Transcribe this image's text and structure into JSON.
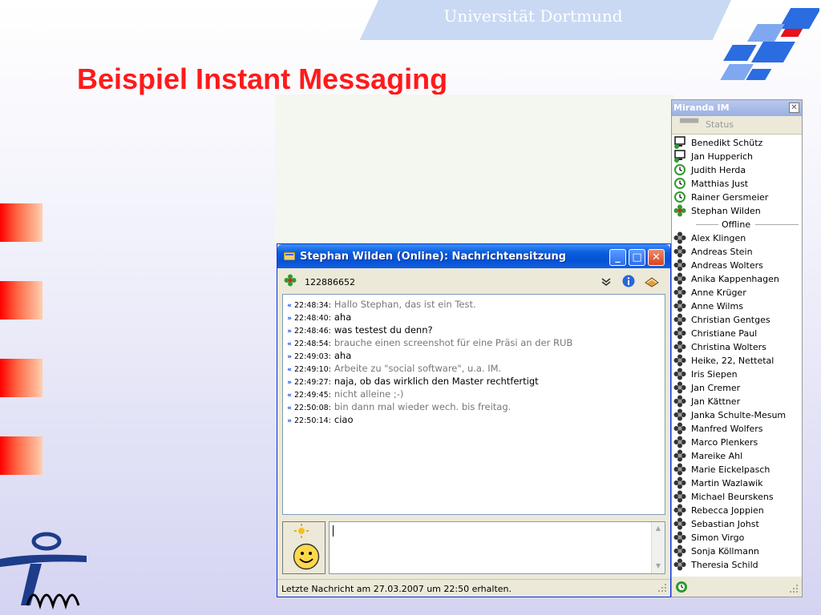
{
  "header": {
    "university": "Universität Dortmund",
    "slide_title": "Beispiel Instant Messaging"
  },
  "chat_window": {
    "title": "Stephan Wilden (Online): Nachrichtensitzung",
    "uin": "122886652",
    "buttons": {
      "minimize": "_",
      "maximize": "□",
      "close": "✕"
    },
    "messages": [
      {
        "dir": "in",
        "time": "22:48:34:",
        "text": "Hallo Stephan, das ist ein Test."
      },
      {
        "dir": "out",
        "time": "22:48:40:",
        "text": "aha"
      },
      {
        "dir": "out",
        "time": "22:48:46:",
        "text": "was testest du denn?"
      },
      {
        "dir": "in",
        "time": "22:48:54:",
        "text": "brauche einen screenshot für eine Präsi an der RUB"
      },
      {
        "dir": "out",
        "time": "22:49:03:",
        "text": "aha"
      },
      {
        "dir": "in",
        "time": "22:49:10:",
        "text": "Arbeite zu \"social software\", u.a. IM."
      },
      {
        "dir": "out",
        "time": "22:49:27:",
        "text": "naja, ob das wirklich den Master rechtfertigt"
      },
      {
        "dir": "in",
        "time": "22:49:45:",
        "text": "nicht alleine ;-)"
      },
      {
        "dir": "in",
        "time": "22:50:08:",
        "text": "bin dann mal wieder wech. bis freitag."
      },
      {
        "dir": "out",
        "time": "22:50:14:",
        "text": "ciao"
      }
    ],
    "status_text": "Letzte Nachricht am 27.03.2007 um 22:50 erhalten."
  },
  "miranda": {
    "title": "Miranda IM",
    "close_label": "✕",
    "status_label": "Status",
    "online_contacts": [
      {
        "name": "Benedikt Schütz",
        "icon": "monitor-icon"
      },
      {
        "name": "Jan Hupperich",
        "icon": "monitor-icon"
      },
      {
        "name": "Judith Herda",
        "icon": "clock-icon"
      },
      {
        "name": "Matthias Just",
        "icon": "clock-icon"
      },
      {
        "name": "Rainer Gersmeier",
        "icon": "clock-icon"
      },
      {
        "name": "Stephan Wilden",
        "icon": "flower-online-icon"
      }
    ],
    "offline_group": "Offline",
    "offline_contacts": [
      "Alex Klingen",
      "Andreas Stein",
      "Andreas Wolters",
      "Anika Kappenhagen",
      "Anne Krüger",
      "Anne Wilms",
      "Christian Gentges",
      "Christiane Paul",
      "Christina Wolters",
      "Heike, 22, Nettetal",
      "Iris Siepen",
      "Jan Cremer",
      "Jan Kättner",
      "Janka Schulte-Mesum",
      "Manfred Wolfers",
      "Marco Plenkers",
      "Mareike Ahl",
      "Marie Eickelpasch",
      "Martin Wazlawik",
      "Michael Beurskens",
      "Rebecca Joppien",
      "Sebastian Johst",
      "Simon Virgo",
      "Sonja Köllmann",
      "Theresia Schild"
    ]
  },
  "colors": {
    "title_red": "#ff1a1a",
    "xp_blue": "#0a5ddc",
    "online_green": "#2e9b2e",
    "offline_dark": "#333333"
  }
}
